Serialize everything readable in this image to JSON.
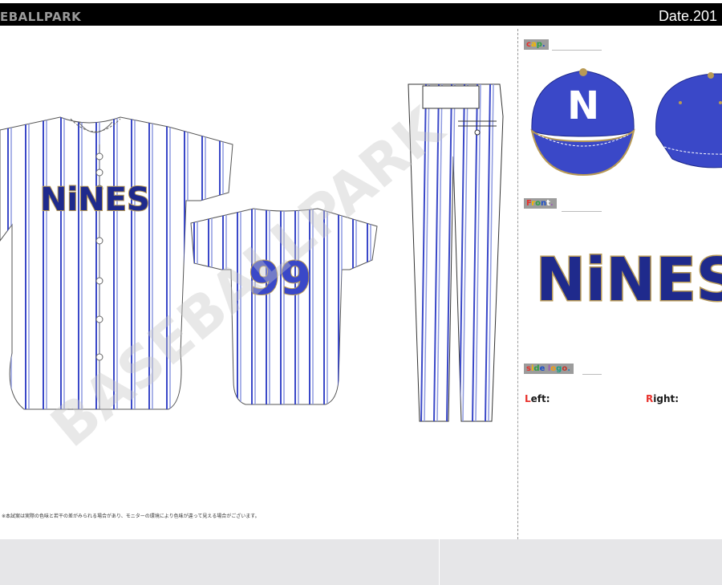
{
  "header": {
    "brand": "EBALLPARK",
    "date": "Date.201"
  },
  "watermark": "BASEBALLPARK",
  "disclaimer": "※本試案は実際の色味と若干の差がみられる場合があり、モニターの環境により色味が違って見える場合がございます。",
  "jersey": {
    "chest_text": "NiNES",
    "back_number": "99"
  },
  "panel": {
    "cap_label": [
      "c",
      "a",
      "p",
      "."
    ],
    "cap_letter": "N",
    "front_label": [
      "F",
      "r",
      "o",
      "n",
      "t",
      "."
    ],
    "front_logo": "NiNES",
    "side_logo_label": [
      "s",
      "i",
      "d",
      "e",
      " ",
      "l",
      "o",
      "g",
      "o",
      "."
    ],
    "left_label": [
      "L",
      "e",
      "f",
      "t",
      ":"
    ],
    "right_label": [
      "R",
      "i",
      "g",
      "h",
      "t",
      ":"
    ]
  },
  "colors": {
    "royal_blue": "#3a48c8",
    "navy": "#1f2a8c",
    "gold_outline": "#b89a55",
    "pinstripe_light": "#8e9ae0",
    "label_palette": [
      "#e8322d",
      "#f5b800",
      "#2f9e44",
      "#1e50c8",
      "#ffffff",
      "#9b59b6",
      "#f39c12",
      "#16a085",
      "#c0392b",
      "#2980b9"
    ]
  }
}
